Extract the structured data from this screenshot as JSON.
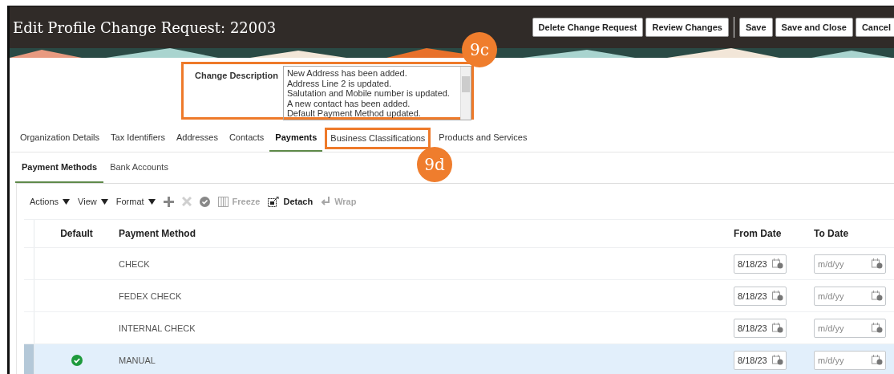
{
  "window": {
    "title": "Edit Profile Change Request: 22003"
  },
  "header_buttons": [
    {
      "label": "Delete Change Request"
    },
    {
      "label": "Review Changes"
    },
    {
      "label": "Save"
    },
    {
      "label": "Save and Close"
    },
    {
      "label": "Cancel"
    }
  ],
  "change_description": {
    "label": "Change Description",
    "lines": [
      "New Address has been added.",
      "Address Line 2 is updated.",
      "Salutation and Mobile number is updated.",
      "A new contact has been added.",
      "Default Payment Method updated."
    ]
  },
  "tabs": [
    {
      "label": "Organization Details",
      "selected": false
    },
    {
      "label": "Tax Identifiers",
      "selected": false
    },
    {
      "label": "Addresses",
      "selected": false
    },
    {
      "label": "Contacts",
      "selected": false
    },
    {
      "label": "Payments",
      "selected": true
    },
    {
      "label": "Business Classifications",
      "selected": false
    },
    {
      "label": "Products and Services",
      "selected": false
    }
  ],
  "subtabs": [
    {
      "label": "Payment Methods",
      "selected": true
    },
    {
      "label": "Bank Accounts",
      "selected": false
    }
  ],
  "toolbar": [
    {
      "kind": "menu",
      "label": "Actions",
      "disabled": false
    },
    {
      "kind": "menu",
      "label": "View",
      "disabled": false
    },
    {
      "kind": "menu",
      "label": "Format",
      "disabled": false
    },
    {
      "kind": "add",
      "disabled": false
    },
    {
      "kind": "delete",
      "disabled": true
    },
    {
      "kind": "done",
      "disabled": false
    },
    {
      "kind": "freeze",
      "label": "Freeze",
      "disabled": true
    },
    {
      "kind": "detach",
      "label": "Detach",
      "disabled": false
    },
    {
      "kind": "wrap",
      "label": "Wrap",
      "disabled": true
    }
  ],
  "table": {
    "columns": [
      "Default",
      "Payment Method",
      "From Date",
      "To Date"
    ],
    "rows": [
      {
        "default": false,
        "method": "CHECK",
        "from_date": "8/18/23",
        "to_date_placeholder": "m/d/yy",
        "selected": false
      },
      {
        "default": false,
        "method": "FEDEX CHECK",
        "from_date": "8/18/23",
        "to_date_placeholder": "m/d/yy",
        "selected": false
      },
      {
        "default": false,
        "method": "INTERNAL CHECK",
        "from_date": "8/18/23",
        "to_date_placeholder": "m/d/yy",
        "selected": false
      },
      {
        "default": true,
        "method": "MANUAL",
        "from_date": "8/18/23",
        "to_date_placeholder": "m/d/yy",
        "selected": true
      }
    ]
  },
  "callouts": [
    {
      "label": "9c"
    },
    {
      "label": "9d"
    }
  ]
}
